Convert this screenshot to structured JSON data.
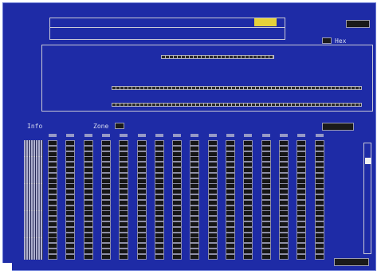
{
  "window": {
    "title_left": "",
    "title_center": ""
  },
  "top": {
    "print_label": "",
    "hex_label": "Hex",
    "note": ""
  },
  "info": {
    "label": "Info",
    "zone_label": "Zone",
    "status": ""
  },
  "grid": {
    "rows": 22,
    "cols": 16
  },
  "bottom": {
    "indicator": ""
  }
}
